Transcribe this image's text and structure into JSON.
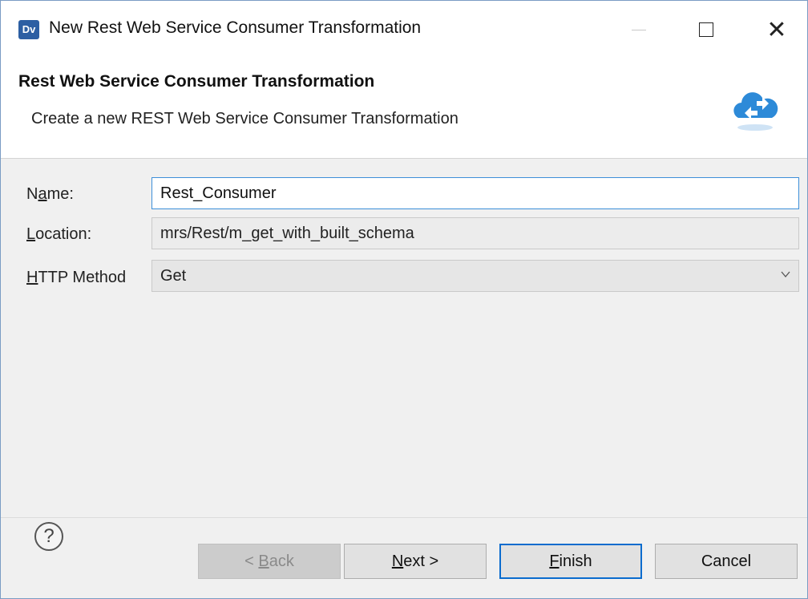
{
  "window": {
    "app_icon_text": "Dv",
    "title": "New Rest Web Service Consumer Transformation"
  },
  "banner": {
    "title": "Rest Web Service Consumer Transformation",
    "description": "Create a new REST Web Service Consumer Transformation",
    "icon": "cloud-exchange-icon"
  },
  "form": {
    "name_label_pre": "N",
    "name_label_mnemonic": "a",
    "name_label_post": "me:",
    "name_value": "Rest_Consumer",
    "location_label_mnemonic": "L",
    "location_label_post": "ocation:",
    "location_value": "mrs/Rest/m_get_with_built_schema",
    "method_label_mnemonic": "H",
    "method_label_post": "TTP Method",
    "method_value": "Get"
  },
  "footer": {
    "help_text": "?",
    "back_pre": "< ",
    "back_mnemonic": "B",
    "back_post": "ack",
    "next_mnemonic": "N",
    "next_post": "ext >",
    "finish_mnemonic": "F",
    "finish_post": "inish",
    "cancel_label": "Cancel"
  },
  "colors": {
    "focus_border": "#3d8fd9",
    "default_button_border": "#0a6cce",
    "icon_blue": "#2d8ad8"
  }
}
